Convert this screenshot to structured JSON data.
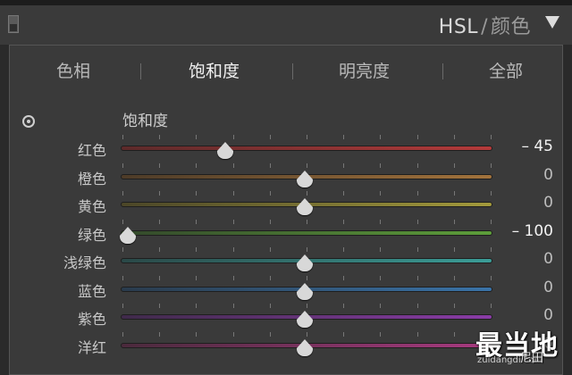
{
  "header": {
    "title_main": "HSL",
    "title_sep": "/",
    "title_alt": "颜色"
  },
  "tabs": [
    {
      "label": "色相",
      "active": false
    },
    {
      "label": "饱和度",
      "active": true
    },
    {
      "label": "明亮度",
      "active": false
    },
    {
      "label": "全部",
      "active": false
    }
  ],
  "section": {
    "title": "饱和度"
  },
  "sliders": [
    {
      "label": "红色",
      "value": "– 45",
      "level": -45,
      "colors": [
        "#5c2a2a",
        "#b43a3a"
      ]
    },
    {
      "label": "橙色",
      "value": "0",
      "level": 0,
      "colors": [
        "#4d3b28",
        "#a2733c"
      ]
    },
    {
      "label": "黄色",
      "value": "0",
      "level": 0,
      "colors": [
        "#4b4628",
        "#a39a3c"
      ]
    },
    {
      "label": "绿色",
      "value": "– 100",
      "level": -100,
      "colors": [
        "#33482b",
        "#5d9e3a"
      ]
    },
    {
      "label": "浅绿色",
      "value": "0",
      "level": 0,
      "colors": [
        "#2a4847",
        "#3b9d97"
      ]
    },
    {
      "label": "蓝色",
      "value": "0",
      "level": 0,
      "colors": [
        "#2a3b4c",
        "#3a73a8"
      ]
    },
    {
      "label": "紫色",
      "value": "0",
      "level": 0,
      "colors": [
        "#3f2a4a",
        "#8a3ca6"
      ]
    },
    {
      "label": "洋红",
      "value": "0",
      "level": 0,
      "colors": [
        "#4a2a3c",
        "#a83a80"
      ]
    }
  ],
  "watermark": {
    "main": "最当地",
    "sub": "zuidangdi.com",
    "weibo": "尼田"
  }
}
